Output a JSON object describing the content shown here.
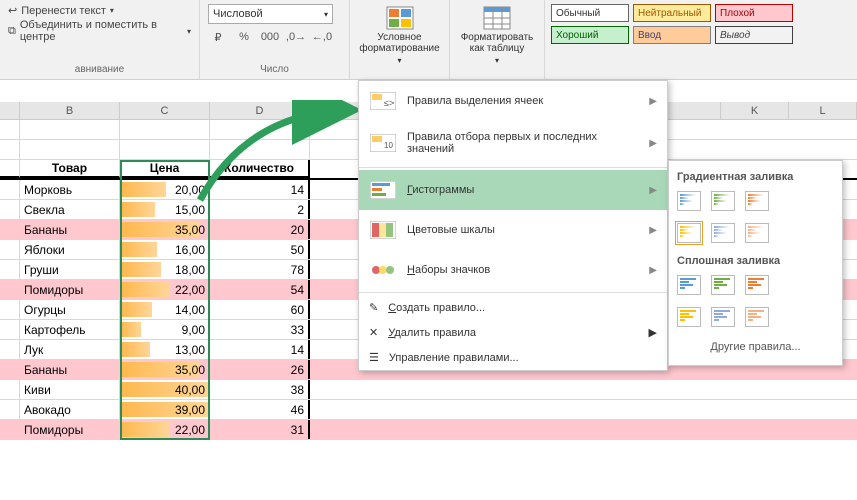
{
  "ribbon": {
    "align": {
      "wrap": "Перенести текст",
      "merge": "Объединить и поместить в центре",
      "group_label": "авнивание"
    },
    "number": {
      "format": "Числовой",
      "group_label": "Число"
    },
    "cf": {
      "label": "Условное форматирование"
    },
    "fmt_table": {
      "label": "Форматировать как таблицу"
    },
    "styles": {
      "normal": "Обычный",
      "neutral": "Нейтральный",
      "bad": "Плохой",
      "good": "Хороший",
      "input": "Ввод",
      "output": "Вывод"
    }
  },
  "cols": {
    "b": "B",
    "c": "C",
    "d": "D",
    "k": "K",
    "l": "L"
  },
  "headers": {
    "product": "Товар",
    "price": "Цена",
    "qty": "Количество"
  },
  "data_rows": [
    {
      "product": "Морковь",
      "price": "20,00",
      "qty": "14",
      "bar": 50,
      "bad": false
    },
    {
      "product": "Свекла",
      "price": "15,00",
      "qty": "2",
      "bar": 38,
      "bad": false
    },
    {
      "product": "Бананы",
      "price": "35,00",
      "qty": "20",
      "bar": 88,
      "bad": true
    },
    {
      "product": "Яблоки",
      "price": "16,00",
      "qty": "50",
      "bar": 40,
      "bad": false
    },
    {
      "product": "Груши",
      "price": "18,00",
      "qty": "78",
      "bar": 45,
      "bad": false
    },
    {
      "product": "Помидоры",
      "price": "22,00",
      "qty": "54",
      "bar": 55,
      "bad": true
    },
    {
      "product": "Огурцы",
      "price": "14,00",
      "qty": "60",
      "bar": 35,
      "bad": false
    },
    {
      "product": "Картофель",
      "price": "9,00",
      "qty": "33",
      "bar": 23,
      "bad": false
    },
    {
      "product": "Лук",
      "price": "13,00",
      "qty": "14",
      "bar": 33,
      "bad": false
    },
    {
      "product": "Бананы",
      "price": "35,00",
      "qty": "26",
      "bar": 88,
      "bad": true
    },
    {
      "product": "Киви",
      "price": "40,00",
      "qty": "38",
      "bar": 100,
      "bad": false
    },
    {
      "product": "Авокадо",
      "price": "39,00",
      "qty": "46",
      "bar": 98,
      "bad": false
    },
    {
      "product": "Помидоры",
      "price": "22,00",
      "qty": "31",
      "bar": 55,
      "bad": true
    }
  ],
  "chart_data": {
    "type": "bar",
    "title": "Цена",
    "categories": [
      "Морковь",
      "Свекла",
      "Бананы",
      "Яблоки",
      "Груши",
      "Помидоры",
      "Огурцы",
      "Картофель",
      "Лук",
      "Бананы",
      "Киви",
      "Авокадо",
      "Помидоры"
    ],
    "values": [
      20,
      15,
      35,
      16,
      18,
      22,
      14,
      9,
      13,
      35,
      40,
      39,
      22
    ],
    "xlabel": "Товар",
    "ylabel": "Цена",
    "ylim": [
      0,
      40
    ]
  },
  "cf_menu": {
    "highlight_rules": "Правила выделения ячеек",
    "top_bottom": "Правила отбора первых и последних значений",
    "data_bars": "Гистограммы",
    "color_scales": "Цветовые шкалы",
    "icon_sets": "Наборы значков",
    "new_rule": "Создать правило...",
    "clear_rules": "Удалить правила",
    "manage_rules": "Управление правилами..."
  },
  "sub_menu": {
    "gradient": "Градиентная заливка",
    "solid": "Сплошная заливка",
    "other": "Другие правила...",
    "colors_gradient": [
      "#5b9bd5",
      "#70ad47",
      "#ed7d31",
      "#ffc000",
      "#8faadc",
      "#f4b183"
    ],
    "colors_solid": [
      "#5b9bd5",
      "#70ad47",
      "#ed7d31",
      "#ffc000",
      "#8faadc",
      "#f4b183"
    ]
  }
}
